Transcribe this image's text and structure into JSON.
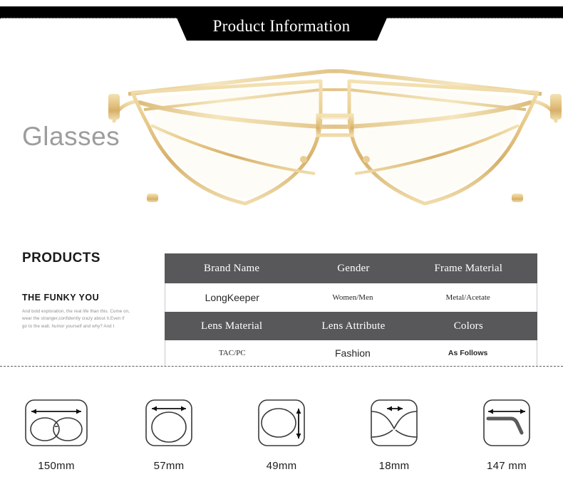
{
  "header": {
    "banner_title": "Product Information"
  },
  "hero": {
    "word": "Glasses",
    "product_image": "gold-cat-eye-glasses-photo"
  },
  "copy": {
    "products_heading": "PRODUCTS",
    "funky_heading": "THE FUNKY YOU",
    "funky_body": "And bold exploration, the real life than this. Come on, wear the stranger,confidently crazy about it.Even if go to the wall, humor yourself and why? And t"
  },
  "spec_table": {
    "header_color": "#58585a",
    "groups": [
      {
        "headers": [
          "Brand Name",
          "Gender",
          "Frame Material"
        ],
        "values": [
          "LongKeeper",
          "Women/Men",
          "Metal/Acetate"
        ]
      },
      {
        "headers": [
          "Lens Material",
          "Lens Attribute",
          "Colors"
        ],
        "values": [
          "TAC/PC",
          "Fashion",
          "As Follows"
        ]
      }
    ]
  },
  "measurements": [
    {
      "label": "150mm",
      "icon": "frame-total-width-icon"
    },
    {
      "label": "57mm",
      "icon": "lens-width-icon"
    },
    {
      "label": "49mm",
      "icon": "lens-height-icon"
    },
    {
      "label": "18mm",
      "icon": "bridge-width-icon"
    },
    {
      "label": "147 mm",
      "icon": "temple-length-icon"
    }
  ]
}
